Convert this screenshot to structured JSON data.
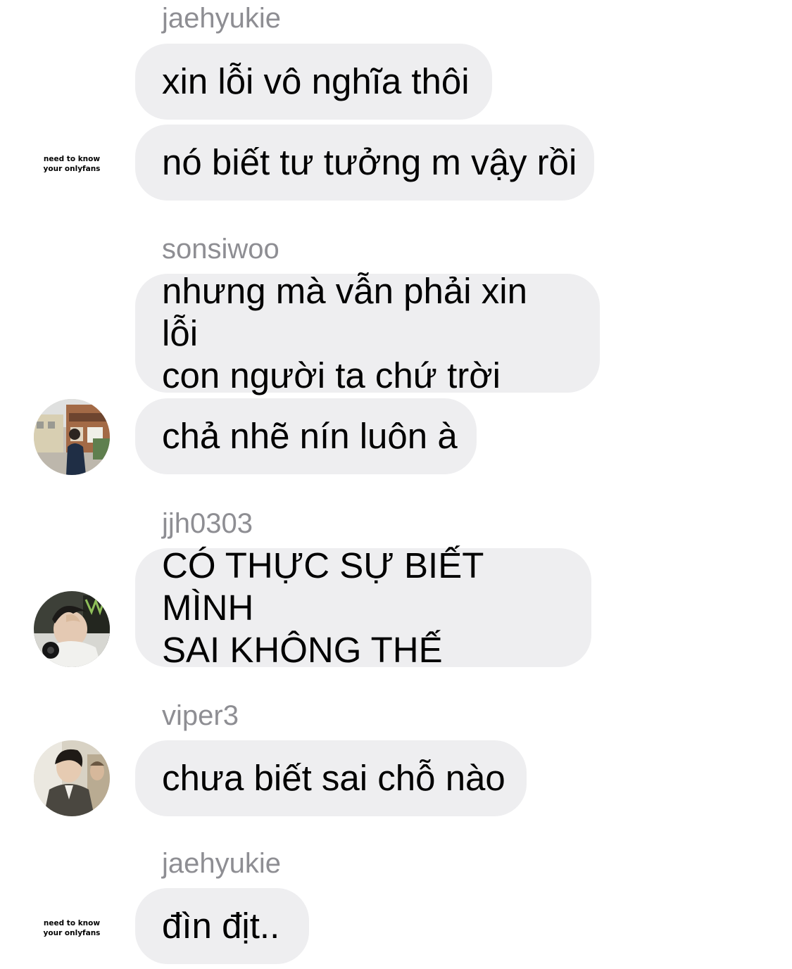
{
  "groups": [
    {
      "sender": "jaehyukie",
      "avatar_text": "need to know\nyour onlyfans",
      "avatar_icon": "text-avatar",
      "messages": [
        "xin lỗi vô nghĩa thôi",
        "nó biết tư tưởng m vậy rồi"
      ]
    },
    {
      "sender": "sonsiwoo",
      "avatar_icon": "photo-avatar-street",
      "messages": [
        "nhưng mà vẫn phải xin lỗi\ncon người ta chứ trời",
        "chả nhẽ nín luôn à"
      ]
    },
    {
      "sender": "jjh0303",
      "avatar_icon": "photo-avatar-headphones",
      "messages": [
        "CÓ THỰC SỰ BIẾT MÌNH\nSAI KHÔNG THẾ"
      ]
    },
    {
      "sender": "viper3",
      "avatar_icon": "photo-avatar-suit",
      "messages": [
        "chưa biết sai chỗ nào"
      ]
    },
    {
      "sender": "jaehyukie",
      "avatar_text": "need to know\nyour onlyfans",
      "avatar_icon": "text-avatar",
      "messages": [
        "đìn địt.."
      ]
    }
  ],
  "colors": {
    "bubble": "#eeeef0",
    "sender_name": "#8e8e93",
    "message_text": "#000000",
    "background": "#ffffff"
  }
}
